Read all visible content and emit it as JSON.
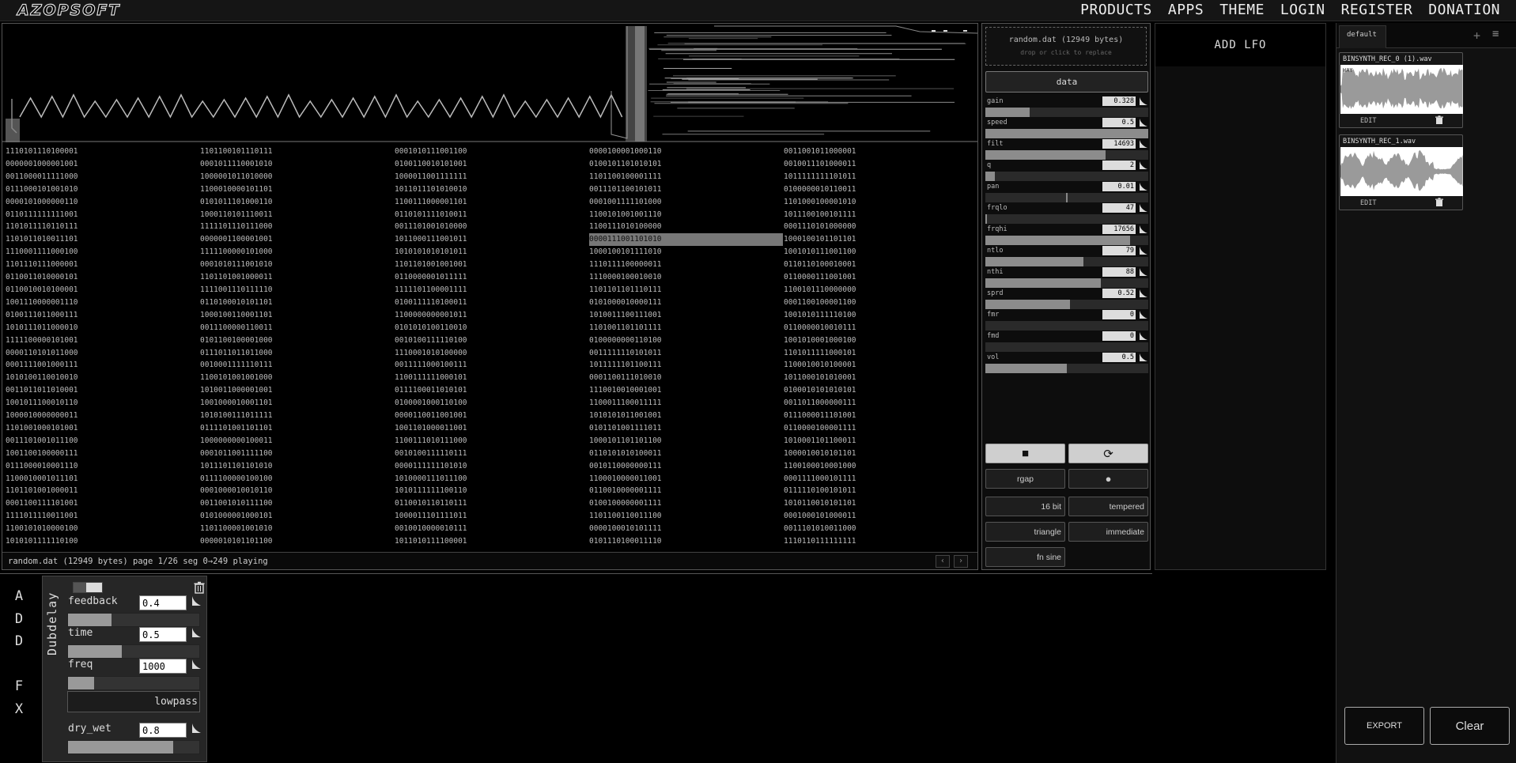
{
  "nav": {
    "logo": "AZOPSOFT",
    "links": [
      "PRODUCTS",
      "APPS",
      "THEME",
      "LOGIN",
      "REGISTER",
      "DONATION"
    ]
  },
  "viewer": {
    "columns": [
      [
        "1110101110100001",
        "0000001000001001",
        "0011000011111000",
        "0111000101001010",
        "0000101000000110",
        "0110111111111001",
        "1101011110110111",
        "1101011010011101",
        "1110001111000100",
        "1101110111000001",
        "0110011010000101",
        "0110010010100001",
        "1001110000001110",
        "0100111011000111",
        "1010111011000010",
        "1111100000101001",
        "0000110101011000",
        "0001111001000111",
        "1010100110010010",
        "0011011011010001",
        "1001011100010110",
        "1000010000000011",
        "1101001000101001",
        "0011101001011100",
        "1001100100000111",
        "0111000010001110",
        "1100010001011101",
        "1101101001000011",
        "0001100111101001",
        "1111011110011001",
        "1100101010000100",
        "1010101111110100"
      ],
      [
        "1101100101110111",
        "0001011110001010",
        "1000001011010000",
        "1100010000101101",
        "0101011101000110",
        "1000110101110011",
        "1111101110111000",
        "0000001100001001",
        "1111100000101000",
        "0001010111001010",
        "1101101001000011",
        "1111001110111110",
        "0110100010101101",
        "1000100110001101",
        "0011100000110011",
        "0101100100001000",
        "0111011011011000",
        "0010001111110111",
        "1100101001001000",
        "1010011000001001",
        "1001000010001101",
        "1010100111011111",
        "0111101001101101",
        "1000000000100011",
        "0001011001111100",
        "1011101101101010",
        "0111100000100100",
        "0001000010010110",
        "0011001010111100",
        "0101000001000101",
        "1101100001001010",
        "0000010101101100"
      ],
      [
        "0001010111001100",
        "0100110010101001",
        "1000011001111111",
        "1011011101010010",
        "1100111000001101",
        "0110101111010011",
        "0011101001010000",
        "1011000111001011",
        "1010101010101011",
        "1101101001001001",
        "0110000001011111",
        "1111101100001111",
        "0100111110100011",
        "1100000000001011",
        "0101010100110010",
        "0010100111110100",
        "1110001010100000",
        "0011111000100111",
        "1100111111000101",
        "0111100011010101",
        "0100001000110100",
        "0000110011001001",
        "1001101000011001",
        "1100111010111000",
        "0010100111110111",
        "0000111111101010",
        "1010000111011100",
        "1010111111100110",
        "0110010110110111",
        "1000011101111011",
        "0010010000010111",
        "1011010111100001"
      ],
      [
        "0000100001000110",
        "0100101101010101",
        "1101100100001111",
        "0011101100101011",
        "0001001111101000",
        "1100101001001110",
        "1100111010100000",
        "0000111001101010",
        "1000100101111010",
        "1110111100000011",
        "1110000100010010",
        "1101101101110111",
        "0101000010000111",
        "1010011100111001",
        "1101001101101111",
        "0100000000110100",
        "0011111110101011",
        "1011111101100111",
        "0001100111010010",
        "1110010010001001",
        "1100011100011111",
        "1010101011001001",
        "0101101001111011",
        "1000101101101100",
        "0110101010100011",
        "0010110000000111",
        "1100010000011001",
        "0110010000001111",
        "0100100000001111",
        "1101100110011100",
        "0000100010101111",
        "0101110100011110"
      ],
      [
        "0011001011000001",
        "0010011101000011",
        "1011111111101011",
        "0100000010110011",
        "1101000100001010",
        "1011100100101111",
        "0001110101000000",
        "1000100101101101",
        "1001010111001100",
        "0110110100010001",
        "0110000111001001",
        "1100101110000000",
        "0001100100001100",
        "1001010111110100",
        "0110000010010111",
        "1001010001000100",
        "1101011111000101",
        "1100010010100001",
        "1011000101010001",
        "0100010101010101",
        "0011011000000111",
        "0111000011101001",
        "0110000100001111",
        "1010001101100011",
        "1000010010101101",
        "1100100010001000",
        "0001111000101111",
        "0111110100101011",
        "1010110010101101",
        "0001000101000011",
        "0011101010011000",
        "1110110111111111"
      ]
    ],
    "highlight": {
      "column": 3,
      "row": 7
    },
    "status_text": "random.dat (12949 bytes)  page 1/26 seg 0→249  playing",
    "prev_glyph": "‹",
    "next_glyph": "›"
  },
  "params": {
    "dropzone_title": "random.dat (12949 bytes)",
    "dropzone_hint": "drop or click to replace",
    "data_label": "data",
    "items": [
      {
        "label": "gain",
        "value": "0.328",
        "level": 0.27
      },
      {
        "label": "speed",
        "value": "0.5",
        "level": 1.0
      },
      {
        "label": "filt",
        "value": "14693",
        "level": 0.74
      },
      {
        "label": "q",
        "value": "2",
        "level": 0.06
      },
      {
        "label": "pan",
        "value": "0.01",
        "level": 0.5,
        "center": true
      },
      {
        "label": "frqlo",
        "value": "47",
        "level": 0.01
      },
      {
        "label": "frqhi",
        "value": "17656",
        "level": 0.89
      },
      {
        "label": "ntlo",
        "value": "79",
        "level": 0.6
      },
      {
        "label": "nthi",
        "value": "88",
        "level": 0.71
      },
      {
        "label": "sprd",
        "value": "0.52",
        "level": 0.52
      },
      {
        "label": "fmr",
        "value": "0",
        "level": 0
      },
      {
        "label": "fmd",
        "value": "0",
        "level": 0
      },
      {
        "label": "vol",
        "value": "0.5",
        "level": 0.5
      }
    ],
    "stop_glyph": "■",
    "loop_glyph": "⟳",
    "rgap_label": "rgap",
    "dot_glyph": "●",
    "bit_label": "16 bit",
    "tempered_label": "tempered",
    "triangle_label": "triangle",
    "immediate_label": "immediate",
    "fn_label": "fn sine"
  },
  "lfo": {
    "add_label": "ADD LFO"
  },
  "files": {
    "tab_label": "default",
    "tab_add_glyph": "+",
    "tab_menu_glyph": "≡",
    "cards": [
      {
        "name": "BINSYNTH_REC_0 (1).wav",
        "edit": "EDIT",
        "tag": "WAV"
      },
      {
        "name": "BINSYNTH_REC_1.wav",
        "edit": "EDIT"
      }
    ],
    "export_label": "EXPORT",
    "clear_label": "Clear"
  },
  "fx": {
    "add_fx": "A\nD\nD\n\nF\nX",
    "title": "Dubdelay",
    "params": [
      {
        "label": "feedback",
        "value": "0.4",
        "level": 0.33
      },
      {
        "label": "time",
        "value": "0.5",
        "level": 0.41
      },
      {
        "label": "freq",
        "value": "1000",
        "level": 0.2
      }
    ],
    "filter_label": "lowpass",
    "dry_wet": {
      "label": "dry_wet",
      "value": "0.8",
      "level": 0.8
    }
  }
}
